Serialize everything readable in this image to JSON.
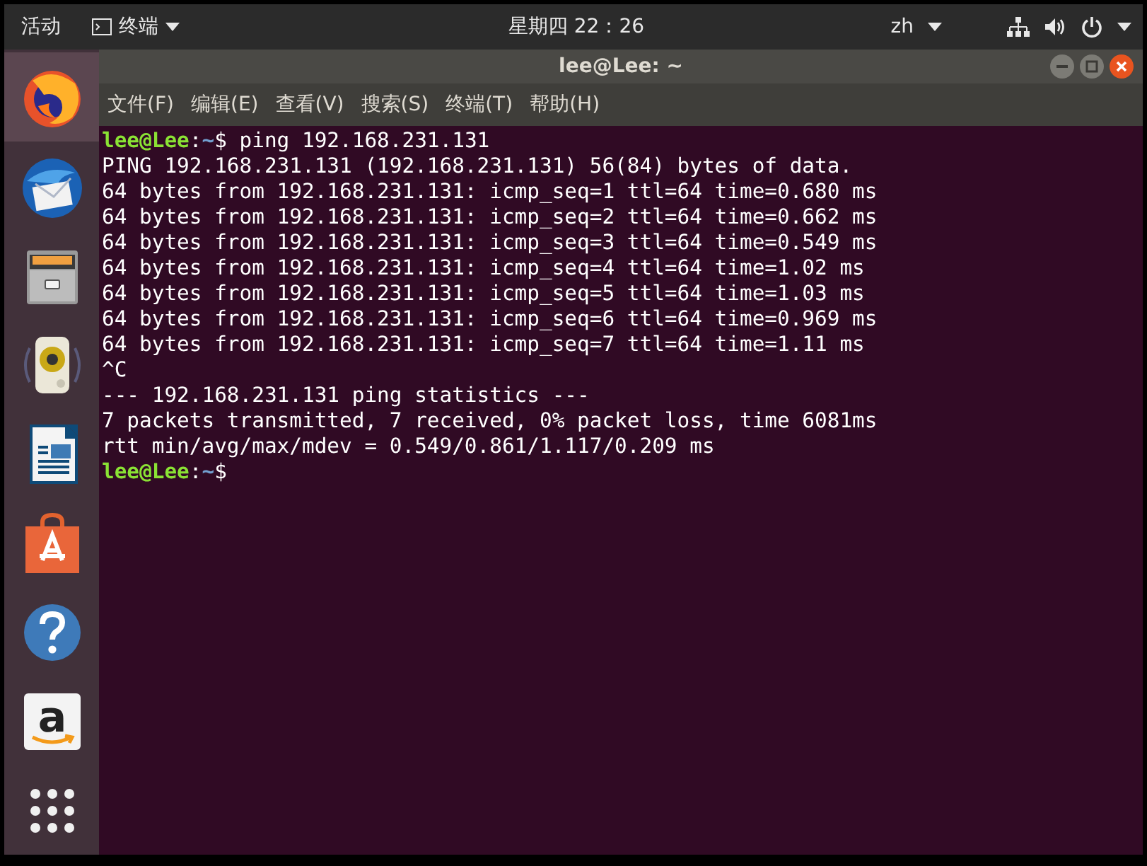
{
  "top_bar": {
    "activities": "活动",
    "app_menu": "终端",
    "clock": "星期四 22：26",
    "input_method": "zh"
  },
  "dock": {
    "items": [
      {
        "kind": "firefox",
        "selected": true
      },
      {
        "kind": "mail",
        "selected": false
      },
      {
        "kind": "files",
        "selected": false
      },
      {
        "kind": "music",
        "selected": false
      },
      {
        "kind": "writer",
        "selected": false
      },
      {
        "kind": "store",
        "selected": false
      },
      {
        "kind": "help",
        "selected": false
      },
      {
        "kind": "amazon",
        "selected": false,
        "glyph": "a"
      },
      {
        "kind": "apps",
        "selected": false
      }
    ]
  },
  "window": {
    "title": "lee@Lee: ~",
    "menu": [
      "文件(F)",
      "编辑(E)",
      "查看(V)",
      "搜索(S)",
      "终端(T)",
      "帮助(H)"
    ],
    "lines": [
      {
        "kind": "prompt",
        "user": "lee@Lee",
        "colon": ":",
        "path": "~",
        "sign": "$ ",
        "command": "ping 192.168.231.131"
      },
      {
        "kind": "output",
        "text": "PING 192.168.231.131 (192.168.231.131) 56(84) bytes of data."
      },
      {
        "kind": "output",
        "text": "64 bytes from 192.168.231.131: icmp_seq=1 ttl=64 time=0.680 ms"
      },
      {
        "kind": "output",
        "text": "64 bytes from 192.168.231.131: icmp_seq=2 ttl=64 time=0.662 ms"
      },
      {
        "kind": "output",
        "text": "64 bytes from 192.168.231.131: icmp_seq=3 ttl=64 time=0.549 ms"
      },
      {
        "kind": "output",
        "text": "64 bytes from 192.168.231.131: icmp_seq=4 ttl=64 time=1.02 ms"
      },
      {
        "kind": "output",
        "text": "64 bytes from 192.168.231.131: icmp_seq=5 ttl=64 time=1.03 ms"
      },
      {
        "kind": "output",
        "text": "64 bytes from 192.168.231.131: icmp_seq=6 ttl=64 time=0.969 ms"
      },
      {
        "kind": "output",
        "text": "64 bytes from 192.168.231.131: icmp_seq=7 ttl=64 time=1.11 ms"
      },
      {
        "kind": "output",
        "text": "^C"
      },
      {
        "kind": "output",
        "text": "--- 192.168.231.131 ping statistics ---"
      },
      {
        "kind": "output",
        "text": "7 packets transmitted, 7 received, 0% packet loss, time 6081ms"
      },
      {
        "kind": "output",
        "text": "rtt min/avg/max/mdev = 0.549/0.861/1.117/0.209 ms"
      },
      {
        "kind": "prompt",
        "user": "lee@Lee",
        "colon": ":",
        "path": "~",
        "sign": "$"
      }
    ]
  }
}
